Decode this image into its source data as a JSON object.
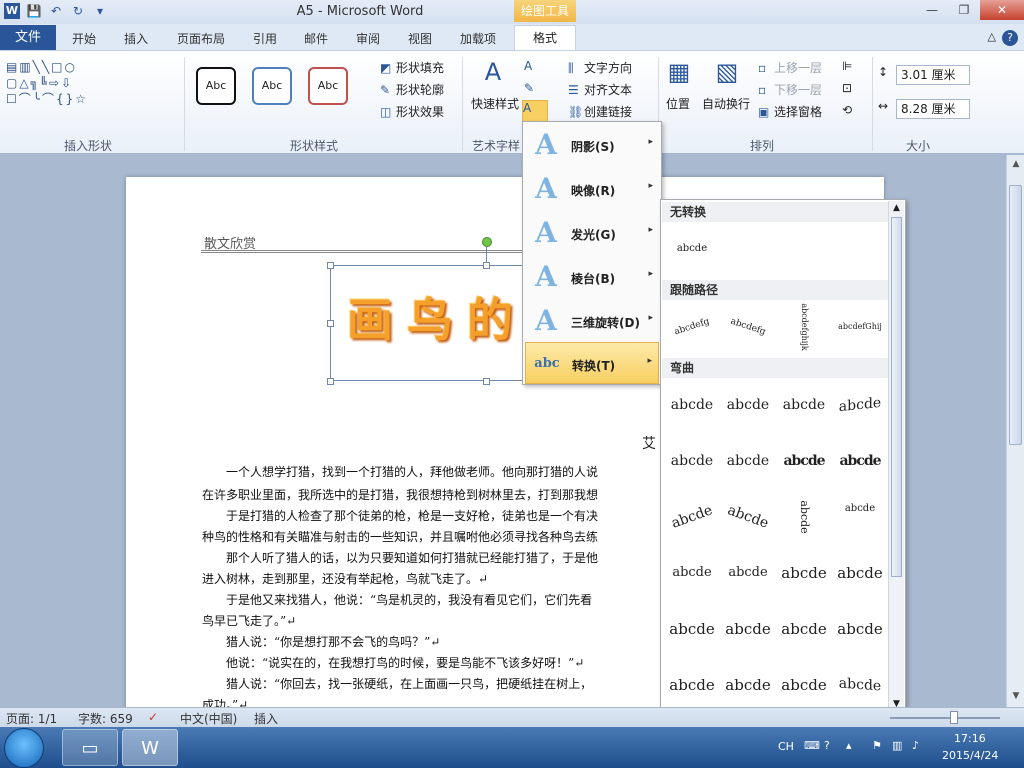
{
  "window": {
    "title": "A5 - Microsoft Word",
    "context_tab_label": "绘图工具",
    "controls": [
      "—",
      "❐",
      "✕"
    ]
  },
  "qat": {
    "save": "💾",
    "undo": "↶",
    "redo": "↻",
    "more": "▾"
  },
  "app_icon": "W",
  "tabs": {
    "file": "文件",
    "items": [
      "开始",
      "插入",
      "页面布局",
      "引用",
      "邮件",
      "审阅",
      "视图",
      "加载项"
    ],
    "active": "格式",
    "minimize": "△",
    "help": "?"
  },
  "ribbon": {
    "groups": {
      "insert_shapes": "插入形状",
      "shape_styles": "形状样式",
      "wordart_styles": "艺术字样",
      "arrange": "排列",
      "size": "大小"
    },
    "shapes_rows": [
      "▤▥╲╲□○",
      "▢△╗╚⇨⇩",
      "☐⌒╰⌒{}☆"
    ],
    "style_sample": "Abc",
    "shape_fill": "形状填充",
    "shape_outline": "形状轮廓",
    "shape_effects": "形状效果",
    "quick_styles": "快速样式",
    "text_direction": "文字方向",
    "align_text": "对齐文本",
    "create_link": "创建链接",
    "position": "位置",
    "auto_wrap": "自动换行",
    "bring_forward": "上移一层",
    "send_backward": "下移一层",
    "selection_pane": "选择窗格",
    "height": "3.01 厘米",
    "width": "8.28 厘米"
  },
  "document": {
    "header": "散文欣赏",
    "wordart": "画鸟的",
    "author": "艾",
    "paragraphs": [
      "　　一个人想学打猎，找到一个打猎的人，拜他做老师。他向那打猎的人说",
      "在许多职业里面，我所选中的是打猎，我很想持枪到树林里去，打到那我想",
      "　　于是打猎的人检查了那个徒弟的枪，枪是一支好枪，徒弟也是一个有决",
      "种鸟的性格和有关瞄准与射击的一些知识，并且嘱咐他必须寻找各种鸟去练",
      "　　那个人听了猎人的话，以为只要知道如何打猎就已经能打猎了，于是他",
      "进入树林，走到那里，还没有举起枪，鸟就飞走了。↵",
      "　　于是他又来找猎人，他说：“鸟是机灵的，我没有看见它们，它们先看",
      "鸟早已飞走了。”↵",
      "　　猎人说：“你是想打那不会飞的鸟吗？”↵",
      "　　他说：“说实在的，在我想打鸟的时候，要是鸟能不飞该多好呀！”↵",
      "　　猎人说：“你回去，找一张硬纸，在上面画一只鸟，把硬纸挂在树上，",
      "成功。”↵"
    ]
  },
  "fx_menu": {
    "items": [
      {
        "icon": "A",
        "label": "阴影(S)",
        "arrow": "▸"
      },
      {
        "icon": "A",
        "label": "映像(R)",
        "arrow": "▸"
      },
      {
        "icon": "A",
        "label": "发光(G)",
        "arrow": "▸"
      },
      {
        "icon": "A",
        "label": "棱台(B)",
        "arrow": "▸"
      },
      {
        "icon": "A",
        "label": "三维旋转(D)",
        "arrow": "▸"
      },
      {
        "icon": "abc",
        "label": "转换(T)",
        "arrow": "▸"
      }
    ]
  },
  "gallery": {
    "no_transform": "无转换",
    "no_transform_sample": "abcde",
    "follow_path": "跟随路径",
    "path_samples": [
      "abcdefg",
      "abcdefg",
      "abcdefghijk",
      "abcdefGhij"
    ],
    "warp": "弯曲",
    "warp_samples": [
      "abcde",
      "abcde",
      "abcde",
      "abcde",
      "abcde",
      "abcde",
      "abcde",
      "abcde",
      "abcde",
      "abcde",
      "abcde",
      "abcde",
      "abcde",
      "abcde",
      "abcde",
      "abcde",
      "abcde",
      "abcde",
      "abcde",
      "abcde",
      "abcde",
      "abcde",
      "abcde",
      "abcde"
    ],
    "grip": "⋯⋯"
  },
  "status": {
    "page": "页面: 1/1",
    "words": "字数: 659",
    "lang": "中文(中国)",
    "insert": "插入"
  },
  "taskbar": {
    "tray": {
      "ime": "CH",
      "time": "17:16",
      "date": "2015/4/24"
    }
  },
  "colors": {
    "file_tab": "#2a5699",
    "context_tab": "#f2b646",
    "wordart": "#f5a02a",
    "menu_highlight": "#f8cf62"
  }
}
